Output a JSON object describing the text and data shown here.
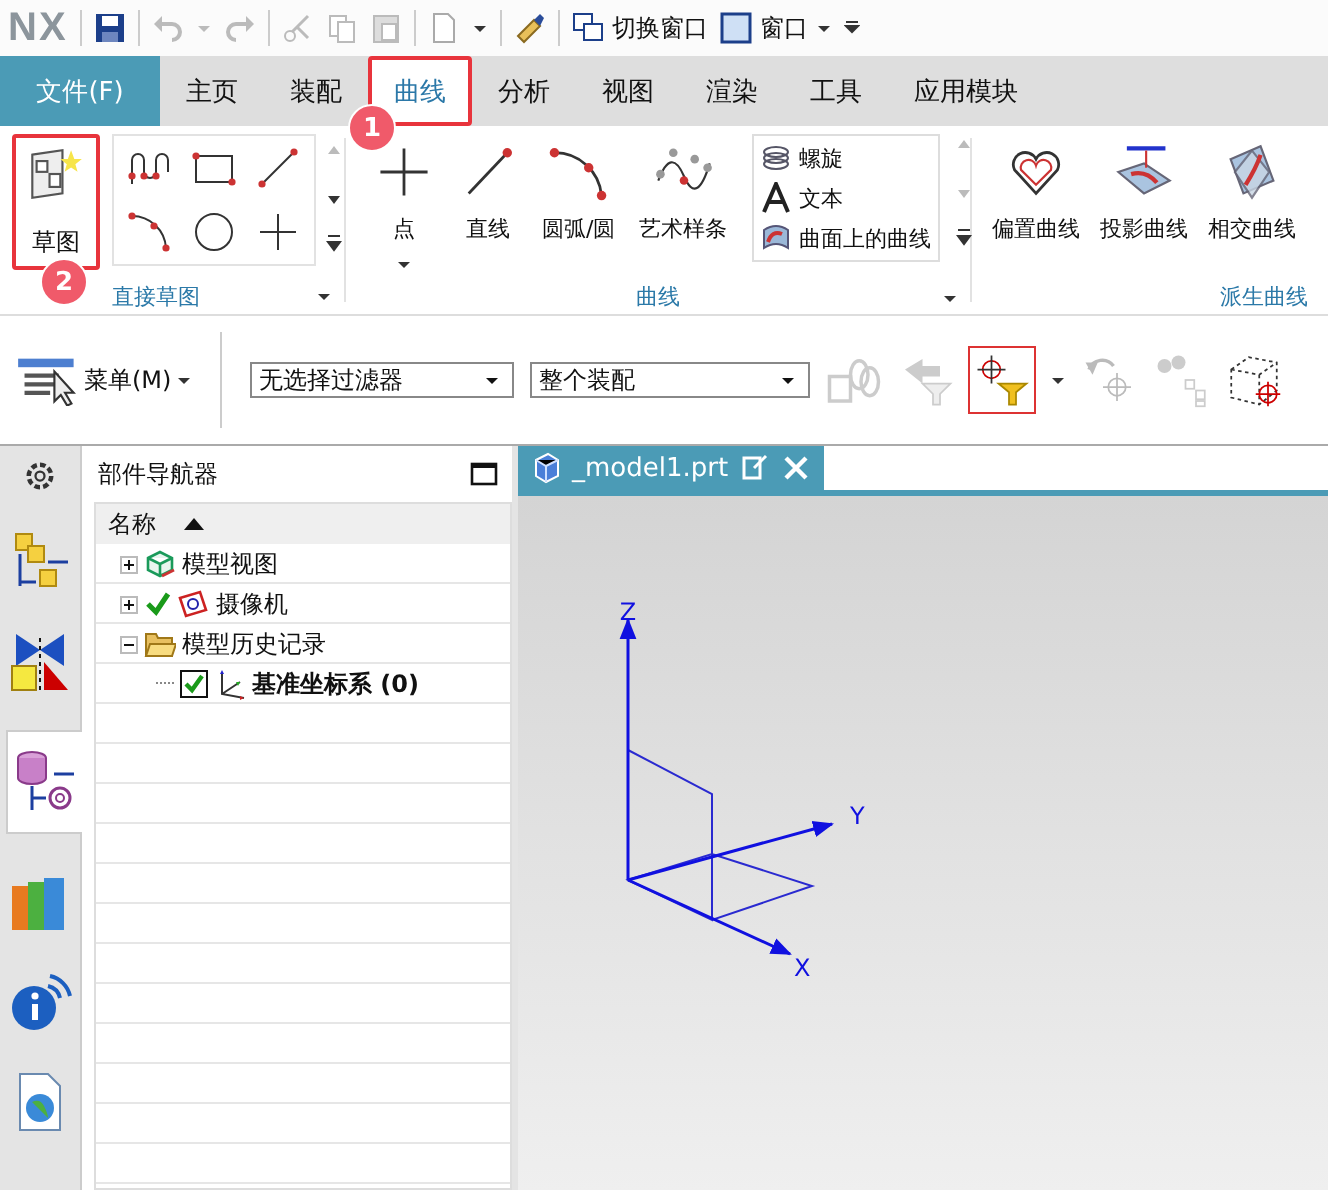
{
  "quick_access": {
    "logo": "NX",
    "switch_window": "切换窗口",
    "window_menu": "窗口"
  },
  "ribbon": {
    "file_tab": "文件(F)",
    "tabs": [
      {
        "label": "主页",
        "selected": false
      },
      {
        "label": "装配",
        "selected": false
      },
      {
        "label": "曲线",
        "selected": true,
        "callout": "1"
      },
      {
        "label": "分析",
        "selected": false
      },
      {
        "label": "视图",
        "selected": false
      },
      {
        "label": "渲染",
        "selected": false
      },
      {
        "label": "工具",
        "selected": false
      },
      {
        "label": "应用模块",
        "selected": false
      }
    ],
    "sketch_group": {
      "title": "直接草图",
      "sketch_button": {
        "label": "草图",
        "callout": "2"
      }
    },
    "curve_group": {
      "title": "曲线",
      "buttons": [
        {
          "label": "点",
          "kind": "point"
        },
        {
          "label": "直线",
          "kind": "line"
        },
        {
          "label": "圆弧/圆",
          "kind": "arc"
        },
        {
          "label": "艺术样条",
          "kind": "spline"
        }
      ],
      "list": [
        {
          "label": "螺旋",
          "kind": "helix"
        },
        {
          "label": "文本",
          "kind": "text"
        },
        {
          "label": "曲面上的曲线",
          "kind": "surface_curve"
        }
      ]
    },
    "derived_group": {
      "title": "派生曲线",
      "buttons": [
        {
          "label": "偏置曲线",
          "kind": "offset"
        },
        {
          "label": "投影曲线",
          "kind": "project"
        },
        {
          "label": "相交曲线",
          "kind": "intersect"
        }
      ]
    }
  },
  "toolbar": {
    "menu": "菜单(M)",
    "selection_filter": "无选择过滤器",
    "assembly_scope": "整个装配"
  },
  "navigator": {
    "title": "部件导航器",
    "column": "名称",
    "tree": [
      {
        "label": "模型视图",
        "kind": "views",
        "expanded": false
      },
      {
        "label": "摄像机",
        "kind": "camera",
        "checked": true,
        "expanded": false
      },
      {
        "label": "模型历史记录",
        "kind": "history",
        "expanded": true,
        "children": [
          {
            "label": "基准坐标系 (0)",
            "kind": "datum",
            "checked": true
          }
        ]
      }
    ]
  },
  "document_tab": {
    "label": "_model1.prt",
    "selected": true
  },
  "graphics": {
    "z_label": "Z",
    "y_label": "Y",
    "x_label": "X"
  }
}
